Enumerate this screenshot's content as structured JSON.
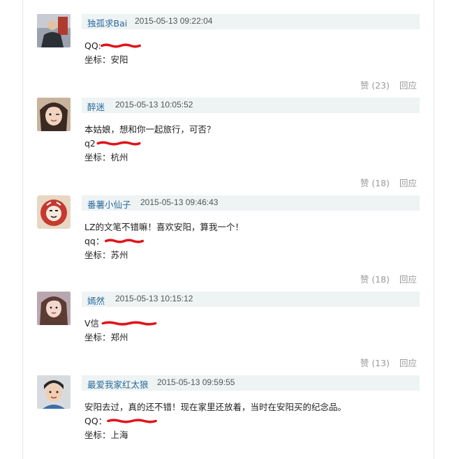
{
  "comments": [
    {
      "username": "独孤求Bai",
      "time": "2015-05-13 09:22:04",
      "lines": [
        "QQ:",
        "坐标：安阳"
      ],
      "like_label": "赞 (23)",
      "reply_label": "回应"
    },
    {
      "username": "醉迷",
      "time": "2015-05-13 10:05:52",
      "lines": [
        "本姑娘，想和你一起旅行，可否？",
        "q2",
        "坐标：杭州"
      ],
      "like_label": "赞 (18)",
      "reply_label": "回应"
    },
    {
      "username": "番薯小仙子",
      "time": "2015-05-13 09:46:43",
      "lines": [
        "LZ的文笔不错嘛！喜欢安阳，算我一个！",
        "qq：",
        "坐标：苏州"
      ],
      "like_label": "赞 (18)",
      "reply_label": "回应"
    },
    {
      "username": "嫣然",
      "time": "2015-05-13 10:15:12",
      "lines": [
        "V信",
        "坐标：郑州"
      ],
      "like_label": "赞 (13)",
      "reply_label": "回应"
    },
    {
      "username": "最爱我家红太狼",
      "time": "2015-05-13 09:59:55",
      "lines": [
        "安阳去过，真的还不错！现在家里还放着，当时在安阳买的纪念品。",
        "QQ：",
        "坐标：上海"
      ]
    }
  ],
  "colors": {
    "username": "#2a6a99",
    "header_bar": "#eef3f4",
    "redaction": "#e0141b"
  }
}
